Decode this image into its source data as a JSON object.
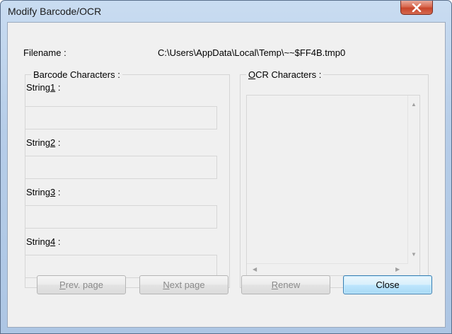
{
  "window": {
    "title": "Modify Barcode/OCR"
  },
  "filename": {
    "label": "Filename :",
    "value": "C:\\Users\\AppData\\Local\\Temp\\~~$FF4B.tmp0"
  },
  "barcode": {
    "group_title": "Barcode Characters :",
    "strings": [
      {
        "pre": "String",
        "key": "1",
        "post": " :"
      },
      {
        "pre": "String",
        "key": "2",
        "post": " :"
      },
      {
        "pre": "String",
        "key": "3",
        "post": " :"
      },
      {
        "pre": "String",
        "key": "4",
        "post": " :"
      }
    ]
  },
  "ocr": {
    "key": "O",
    "rest": "CR Characters :"
  },
  "buttons": {
    "prev": {
      "key": "P",
      "rest": "rev. page"
    },
    "next": {
      "key": "N",
      "rest": "ext page"
    },
    "renew": {
      "key": "R",
      "rest": "enew"
    },
    "close": "Close"
  },
  "icons": {
    "close": "close-icon",
    "up": "scroll-up-arrow-icon",
    "down": "scroll-down-arrow-icon",
    "left": "scroll-left-arrow-icon",
    "right": "scroll-right-arrow-icon"
  },
  "colors": {
    "close_button": "#c8452b",
    "default_button_border": "#3c7fb1",
    "dialog_bg": "#f0f0f0"
  }
}
